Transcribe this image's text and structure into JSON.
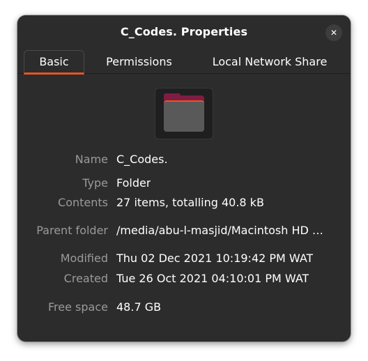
{
  "window": {
    "title": "C_Codes. Properties",
    "close_glyph": "✕"
  },
  "tabs": [
    {
      "label": "Basic",
      "active": true
    },
    {
      "label": "Permissions",
      "active": false
    },
    {
      "label": "Local Network Share",
      "active": false
    }
  ],
  "icon": {
    "name": "folder-icon"
  },
  "properties": {
    "name_label": "Name",
    "name_value": "C_Codes.",
    "type_label": "Type",
    "type_value": "Folder",
    "contents_label": "Contents",
    "contents_value": "27 items, totalling 40.8 kB",
    "parent_label": "Parent folder",
    "parent_value": "/media/abu-l-masjid/Macintosh HD …",
    "modified_label": "Modified",
    "modified_value": "Thu 02 Dec 2021 10:19:42 PM WAT",
    "created_label": "Created",
    "created_value": "Tue 26 Oct 2021 04:10:01 PM WAT",
    "freespace_label": "Free space",
    "freespace_value": "48.7 GB"
  },
  "colors": {
    "background": "#2c2c2c",
    "accent": "#e95420",
    "folder_back": "#7d1d44",
    "label_text": "#9a9a9a",
    "value_text": "#ffffff"
  }
}
